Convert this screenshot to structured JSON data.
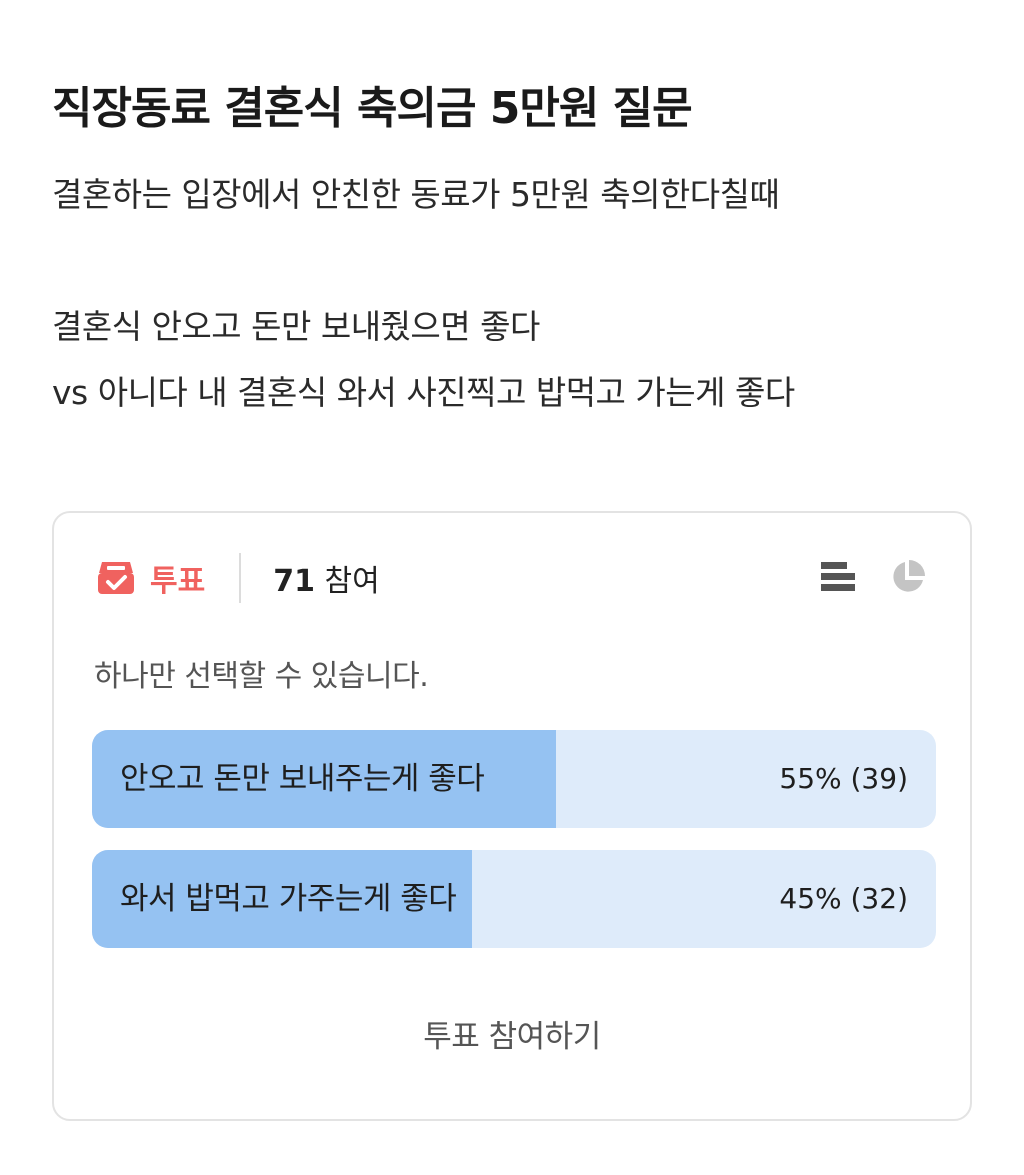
{
  "post": {
    "title": "직장동료 결혼식 축의금 5만원 질문",
    "body_lines": [
      "결혼하는 입장에서 안친한 동료가 5만원 축의한다칠때",
      "",
      "결혼식 안오고 돈만 보내줬으면 좋다",
      "vs 아니다 내 결혼식 와서 사진찍고 밥먹고 가는게 좋다"
    ]
  },
  "poll": {
    "label": "투표",
    "participants_count": "71",
    "participants_suffix": "참여",
    "note": "하나만 선택할 수 있습니다.",
    "icons": {
      "poll": "ballot-box-icon",
      "list_view": "bar-list-icon",
      "chart_view": "pie-chart-icon"
    },
    "accent_color": "#f0625f",
    "bar_fill_color": "#95c2f2",
    "bar_track_color": "#deebfa",
    "options": [
      {
        "label": "안오고 돈만 보내주는게 좋다",
        "result": "55% (39)",
        "percent": 55
      },
      {
        "label": "와서 밥먹고 가주는게 좋다",
        "result": "45% (32)",
        "percent": 45
      }
    ],
    "vote_button": "투표 참여하기"
  }
}
